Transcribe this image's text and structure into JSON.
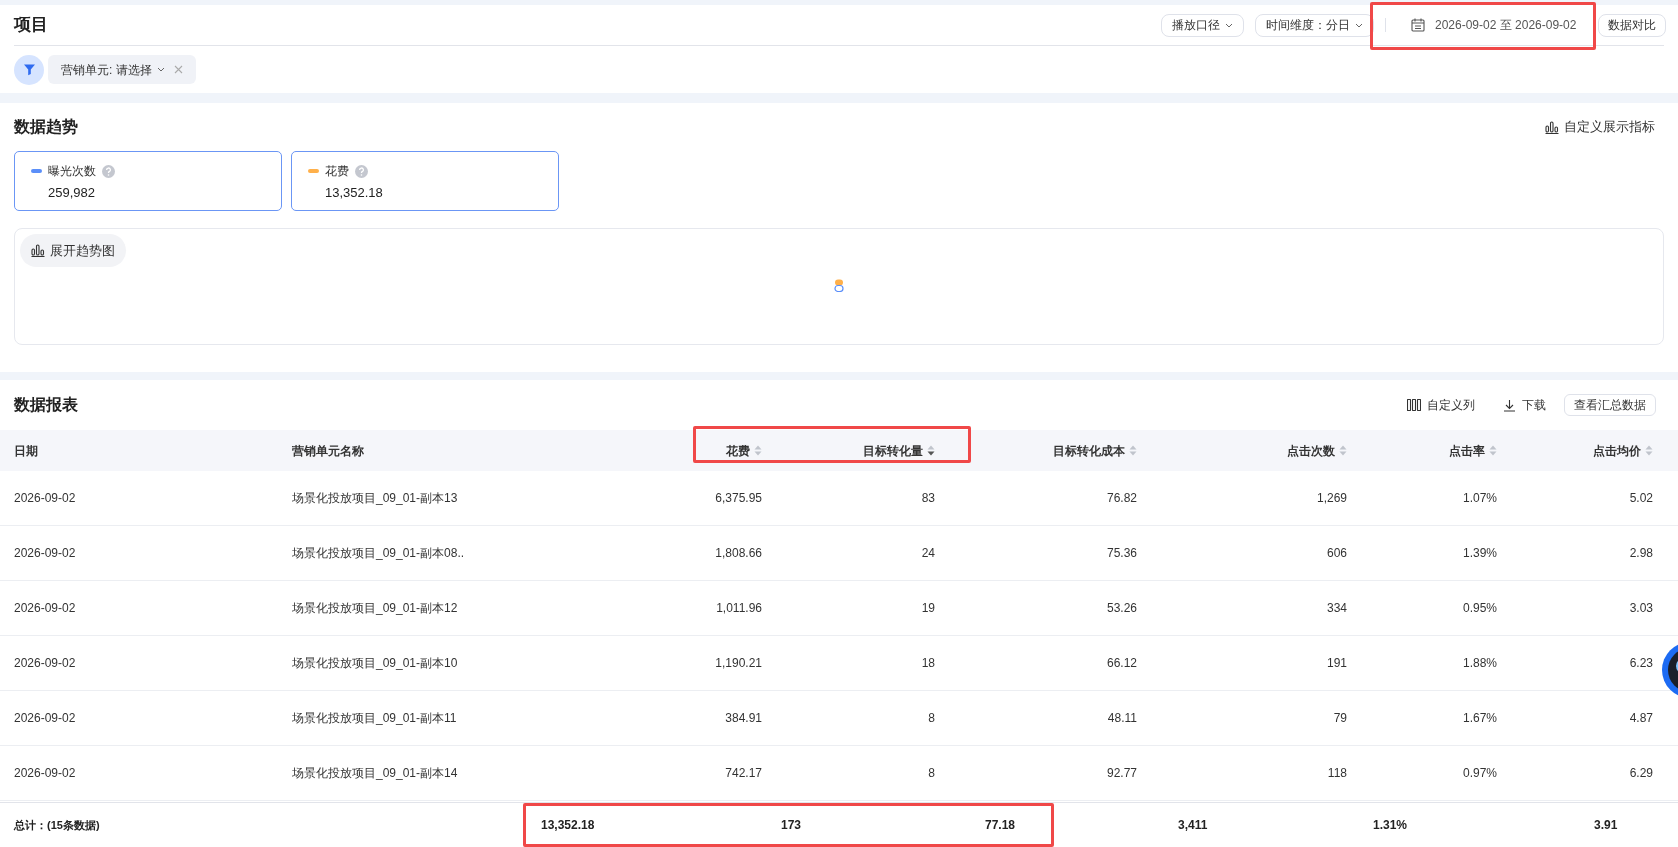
{
  "header": {
    "title": "项目",
    "controls": [
      {
        "label": "播放口径",
        "kind": "dropdown"
      },
      {
        "label": "时间维度：分日",
        "kind": "dropdown"
      }
    ],
    "date_range": "2026-09-02 至 2026-09-02",
    "compare_button": "数据对比"
  },
  "filter": {
    "label": "营销单元: 请选择"
  },
  "trend": {
    "title": "数据趋势",
    "customize": "自定义展示指标",
    "metrics": [
      {
        "name": "曝光次数",
        "value": "259,982",
        "color": "#5b8ff9",
        "selected": true
      },
      {
        "name": "花费",
        "value": "13,352.18",
        "color": "#ffb04a",
        "selected": true
      }
    ],
    "expand_button": "展开趋势图"
  },
  "report": {
    "title": "数据报表",
    "actions": [
      {
        "label": "自定义列",
        "kind": "columns"
      },
      {
        "label": "下载",
        "kind": "download"
      },
      {
        "label": "查看汇总数据",
        "kind": "button"
      }
    ],
    "columns": [
      {
        "label": "日期",
        "sortable": false
      },
      {
        "label": "营销单元名称",
        "sortable": false
      },
      {
        "label": "花费",
        "sortable": true,
        "sorted": false
      },
      {
        "label": "目标转化量",
        "sortable": true,
        "sorted": true
      },
      {
        "label": "目标转化成本",
        "sortable": true,
        "sorted": false
      },
      {
        "label": "点击次数",
        "sortable": true,
        "sorted": false
      },
      {
        "label": "点击率",
        "sortable": true,
        "sorted": false
      },
      {
        "label": "点击均价",
        "sortable": true,
        "sorted": false
      }
    ],
    "rows": [
      [
        "2026-09-02",
        "场景化投放项目_09_01-副本13",
        "6,375.95",
        "83",
        "76.82",
        "1,269",
        "1.07%",
        "5.02"
      ],
      [
        "2026-09-02",
        "场景化投放项目_09_01-副本08..",
        "1,808.66",
        "24",
        "75.36",
        "606",
        "1.39%",
        "2.98"
      ],
      [
        "2026-09-02",
        "场景化投放项目_09_01-副本12",
        "1,011.96",
        "19",
        "53.26",
        "334",
        "0.95%",
        "3.03"
      ],
      [
        "2026-09-02",
        "场景化投放项目_09_01-副本10",
        "1,190.21",
        "18",
        "66.12",
        "191",
        "1.88%",
        "6.23"
      ],
      [
        "2026-09-02",
        "场景化投放项目_09_01-副本11",
        "384.91",
        "8",
        "48.11",
        "79",
        "1.67%",
        "4.87"
      ],
      [
        "2026-09-02",
        "场景化投放项目_09_01-副本14",
        "742.17",
        "8",
        "92.77",
        "118",
        "0.97%",
        "6.29"
      ]
    ],
    "totals": {
      "label": "总计：(15条数据)",
      "values": [
        "13,352.18",
        "173",
        "77.18",
        "3,411",
        "1.31%",
        "3.91"
      ]
    }
  },
  "highlights": [
    {
      "kind": "date_range"
    },
    {
      "kind": "header"
    },
    {
      "kind": "totals"
    }
  ]
}
